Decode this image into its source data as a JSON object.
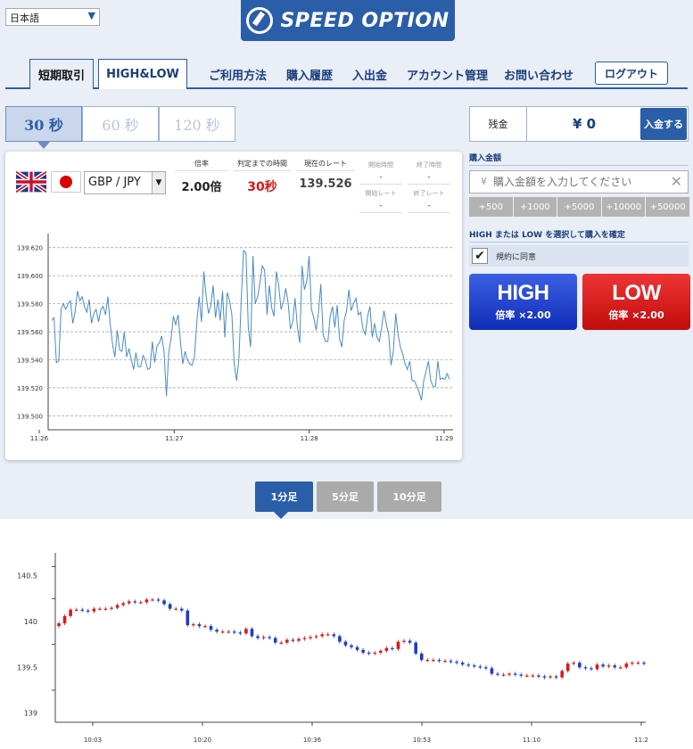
{
  "language": {
    "selected": "日本語"
  },
  "brand": {
    "name": "SPEED OPTION"
  },
  "nav": {
    "tabs": [
      "短期取引",
      "HIGH&LOW"
    ],
    "links": [
      "ご利用方法",
      "購入履歴",
      "入出金",
      "アカウント管理",
      "お問い合わせ"
    ],
    "logout": "ログアウト"
  },
  "durations": [
    "30 秒",
    "60 秒",
    "120 秒"
  ],
  "trade": {
    "pair": "GBP / JPY",
    "payout_label": "倍率",
    "payout": "2.00倍",
    "time_label": "判定までの時間",
    "time": "30秒",
    "rate_label": "現在のレート",
    "rate": "139.526",
    "start_time_label": "開始時間",
    "start_time": "-",
    "end_time_label": "終了時間",
    "end_time": "-",
    "start_rate_label": "開始レート",
    "start_rate": "-",
    "end_rate_label": "終了レート",
    "end_rate": "-"
  },
  "account": {
    "balance_label": "残金",
    "balance": "¥ 0",
    "deposit": "入金する",
    "amount_title": "購入金額",
    "yen": "¥",
    "amount_placeholder": "購入金額を入力してください",
    "add_buttons": [
      "+500",
      "+1000",
      "+5000",
      "+10000",
      "+50000"
    ],
    "confirm_title": "HIGH または LOW を選択して購入を確定",
    "agree": "規約に同意",
    "high": "HIGH",
    "high_rate": "倍率 ×2.00",
    "low": "LOW",
    "low_rate": "倍率 ×2.00"
  },
  "candle_tabs": [
    "1分足",
    "5分足",
    "10分足"
  ],
  "colors": {
    "brand": "#2b5ea8",
    "high": "#1a3ccc",
    "low": "#d61a1a",
    "line": "#4a8bc4"
  },
  "chart_data": [
    {
      "type": "line",
      "x_ticks": [
        "11:26",
        "11:27",
        "11:28",
        "11:29"
      ],
      "y_ticks": [
        "139.620",
        "139.600",
        "139.580",
        "139.560",
        "139.540",
        "139.520",
        "139.500"
      ],
      "ylim": [
        139.49,
        139.63
      ],
      "grid": true,
      "values": [
        139.568,
        139.57,
        139.538,
        139.539,
        139.576,
        139.58,
        139.576,
        139.58,
        139.582,
        139.566,
        139.574,
        139.589,
        139.582,
        139.585,
        139.578,
        139.574,
        139.583,
        139.566,
        139.573,
        139.576,
        139.567,
        139.576,
        139.578,
        139.572,
        139.585,
        139.565,
        139.551,
        139.542,
        139.561,
        139.547,
        139.546,
        139.56,
        139.542,
        139.548,
        139.54,
        139.533,
        139.545,
        139.535,
        139.535,
        139.543,
        139.54,
        139.533,
        139.534,
        139.553,
        139.538,
        139.55,
        139.552,
        139.557,
        139.546,
        139.514,
        139.545,
        139.555,
        139.571,
        139.565,
        139.572,
        139.553,
        139.537,
        139.546,
        139.54,
        139.537,
        139.536,
        139.542,
        139.567,
        139.585,
        139.567,
        139.603,
        139.585,
        139.573,
        139.579,
        139.593,
        139.57,
        139.583,
        139.568,
        139.589,
        139.556,
        139.588,
        139.582,
        139.572,
        139.537,
        139.525,
        139.541,
        139.583,
        139.618,
        139.616,
        139.563,
        139.549,
        139.614,
        139.58,
        139.585,
        139.595,
        139.607,
        139.604,
        139.572,
        139.593,
        139.577,
        139.571,
        139.603,
        139.593,
        139.576,
        139.581,
        139.591,
        139.581,
        139.562,
        139.567,
        139.584,
        139.563,
        139.552,
        139.607,
        139.59,
        139.596,
        139.614,
        139.576,
        139.57,
        139.561,
        139.574,
        139.594,
        139.558,
        139.553,
        139.553,
        139.571,
        139.578,
        139.563,
        139.579,
        139.555,
        139.549,
        139.568,
        139.575,
        139.59,
        139.575,
        139.58,
        139.584,
        139.572,
        139.574,
        139.562,
        139.558,
        139.571,
        139.578,
        139.556,
        139.566,
        139.556,
        139.553,
        139.563,
        139.575,
        139.565,
        139.558,
        139.536,
        139.546,
        139.573,
        139.558,
        139.549,
        139.544,
        139.537,
        139.533,
        139.539,
        139.525,
        139.525,
        139.521,
        139.517,
        139.511,
        139.525,
        139.532,
        139.539,
        139.525,
        139.521,
        139.521,
        139.539,
        139.526,
        139.527,
        139.526,
        139.53,
        139.526
      ]
    },
    {
      "type": "candlestick",
      "x_ticks": [
        "10:03",
        "10:20",
        "10:36",
        "10:53",
        "11:10",
        "11:2"
      ],
      "y_ticks": [
        "140.5",
        "140",
        "139.5",
        "139"
      ],
      "ylim": [
        138.9,
        140.75
      ],
      "values": [
        139.98,
        140.06,
        140.13,
        140.13,
        140.12,
        140.11,
        140.14,
        140.14,
        140.14,
        140.15,
        140.18,
        140.2,
        140.22,
        140.21,
        140.21,
        140.24,
        140.24,
        140.23,
        140.19,
        140.14,
        140.14,
        140.12,
        139.96,
        139.97,
        139.95,
        139.95,
        139.91,
        139.89,
        139.89,
        139.89,
        139.88,
        139.87,
        139.92,
        139.84,
        139.82,
        139.83,
        139.82,
        139.77,
        139.77,
        139.8,
        139.79,
        139.81,
        139.82,
        139.83,
        139.84,
        139.86,
        139.86,
        139.84,
        139.78,
        139.74,
        139.72,
        139.69,
        139.66,
        139.65,
        139.66,
        139.68,
        139.71,
        139.7,
        139.78,
        139.79,
        139.77,
        139.65,
        139.58,
        139.58,
        139.58,
        139.57,
        139.57,
        139.56,
        139.55,
        139.53,
        139.52,
        139.51,
        139.5,
        139.49,
        139.43,
        139.42,
        139.42,
        139.43,
        139.42,
        139.41,
        139.41,
        139.41,
        139.4,
        139.39,
        139.4,
        139.39,
        139.46,
        139.54,
        139.55,
        139.5,
        139.49,
        139.48,
        139.53,
        139.51,
        139.52,
        139.5,
        139.5,
        139.54,
        139.55,
        139.55,
        139.54
      ]
    }
  ]
}
